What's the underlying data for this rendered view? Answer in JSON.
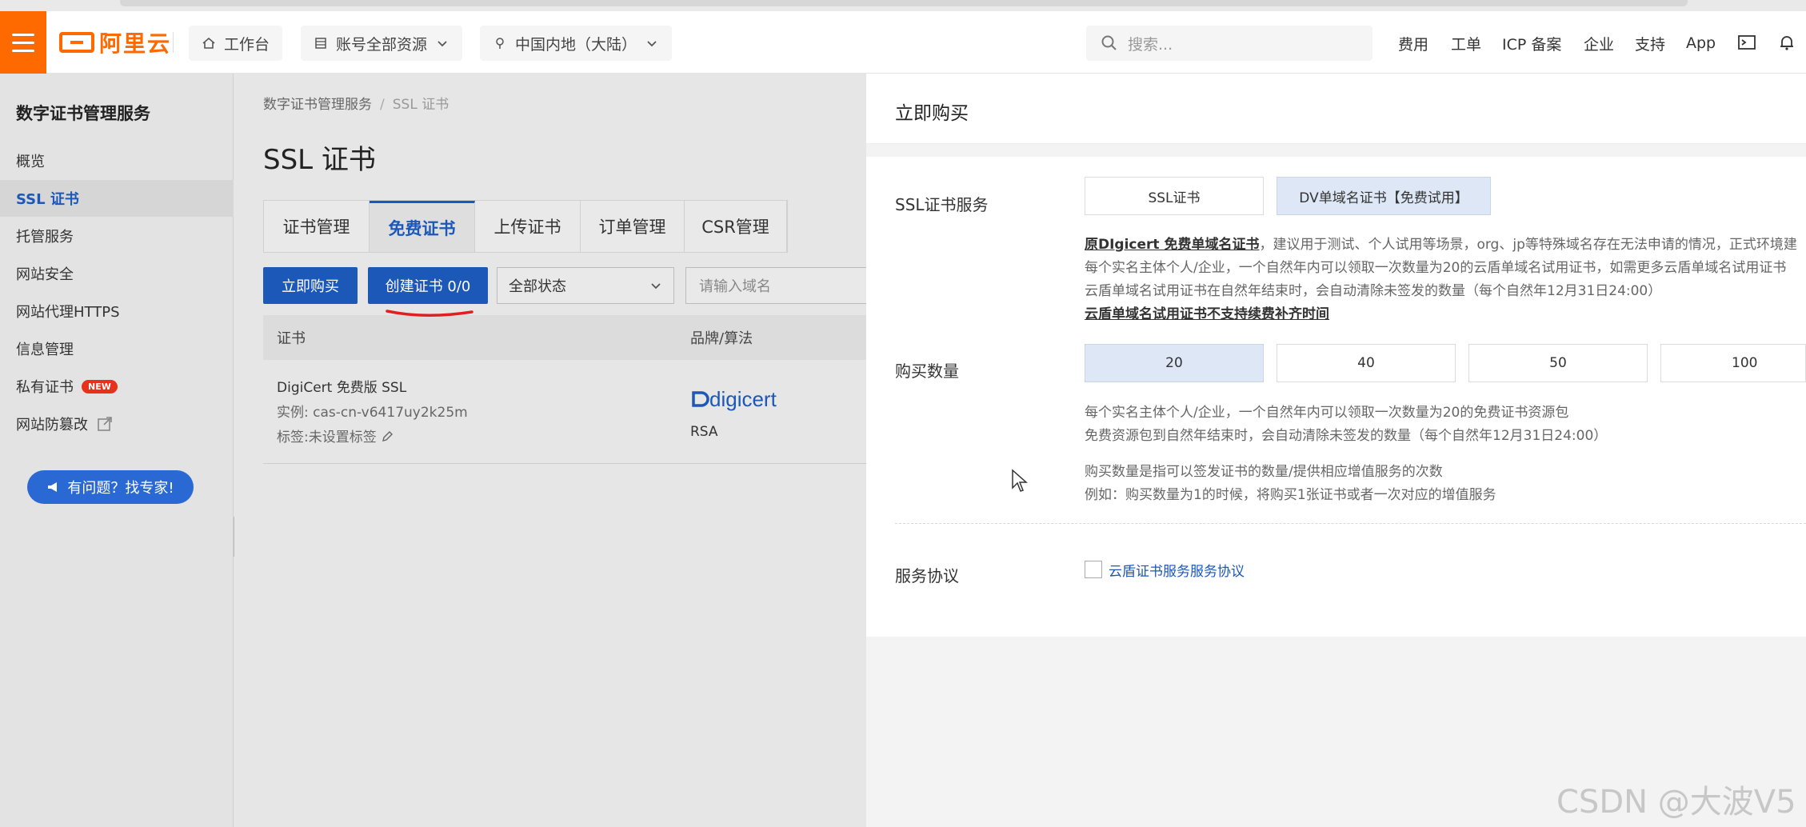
{
  "header": {
    "logo_text": "阿里云",
    "workbench": "工作台",
    "account_resources": "账号全部资源",
    "region": "中国内地（大陆）",
    "search_placeholder": "搜索...",
    "links": [
      "费用",
      "工单",
      "ICP 备案",
      "企业",
      "支持",
      "App"
    ]
  },
  "sidebar": {
    "title": "数字证书管理服务",
    "items": [
      {
        "label": "概览"
      },
      {
        "label": "SSL 证书"
      },
      {
        "label": "托管服务"
      },
      {
        "label": "网站安全"
      },
      {
        "label": "网站代理HTTPS"
      },
      {
        "label": "信息管理"
      },
      {
        "label": "私有证书",
        "badge": "NEW"
      },
      {
        "label": "网站防篡改"
      }
    ],
    "expert_button": "有问题？找专家!"
  },
  "main": {
    "breadcrumb": [
      "数字证书管理服务",
      "SSL 证书"
    ],
    "title": "SSL 证书",
    "tabs": [
      "证书管理",
      "免费证书",
      "上传证书",
      "订单管理",
      "CSR管理"
    ],
    "buy_button": "立即购买",
    "create_button": "创建证书 0/0",
    "status_select": "全部状态",
    "domain_placeholder": "请输入域名",
    "table_headers": [
      "证书",
      "品牌/算法"
    ],
    "row": {
      "name": "DigiCert 免费版 SSL",
      "instance": "实例: cas-cn-v6417uy2k25m",
      "tag": "标签:未设置标签",
      "brand": "digicert",
      "algo": "RSA"
    }
  },
  "drawer": {
    "title": "立即购买",
    "service_label": "SSL证书服务",
    "service_options": [
      "SSL证书",
      "DV单域名证书【免费试用】"
    ],
    "service_notes": {
      "bold_prefix": "原DIgicert 免费单域名证书",
      "line1_rest": "，建议用于测试、个人试用等场景，org、jp等特殊域名存在无法申请的情况，正式环境建",
      "line2": "每个实名主体个人/企业，一个自然年内可以领取一次数量为20的云盾单域名试用证书，如需更多云盾单域名试用证书",
      "line3": "云盾单域名试用证书在自然年结束时，会自动清除未签发的数量（每个自然年12月31日24:00）",
      "line4": "云盾单域名试用证书不支持续费补齐时间"
    },
    "quantity_label": "购买数量",
    "quantity_options": [
      "20",
      "40",
      "50",
      "100"
    ],
    "quantity_notes": [
      "每个实名主体个人/企业，一个自然年内可以领取一次数量为20的免费证书资源包",
      "免费资源包到自然年结束时，会自动清除未签发的数量（每个自然年12月31日24:00）",
      "购买数量是指可以签发证书的数量/提供相应增值服务的次数",
      "例如：购买数量为1的时候，将购买1张证书或者一次对应的增值服务"
    ],
    "agreement_label": "服务协议",
    "agreement_link": "云盾证书服务服务协议"
  },
  "watermark": "CSDN @大波V5"
}
